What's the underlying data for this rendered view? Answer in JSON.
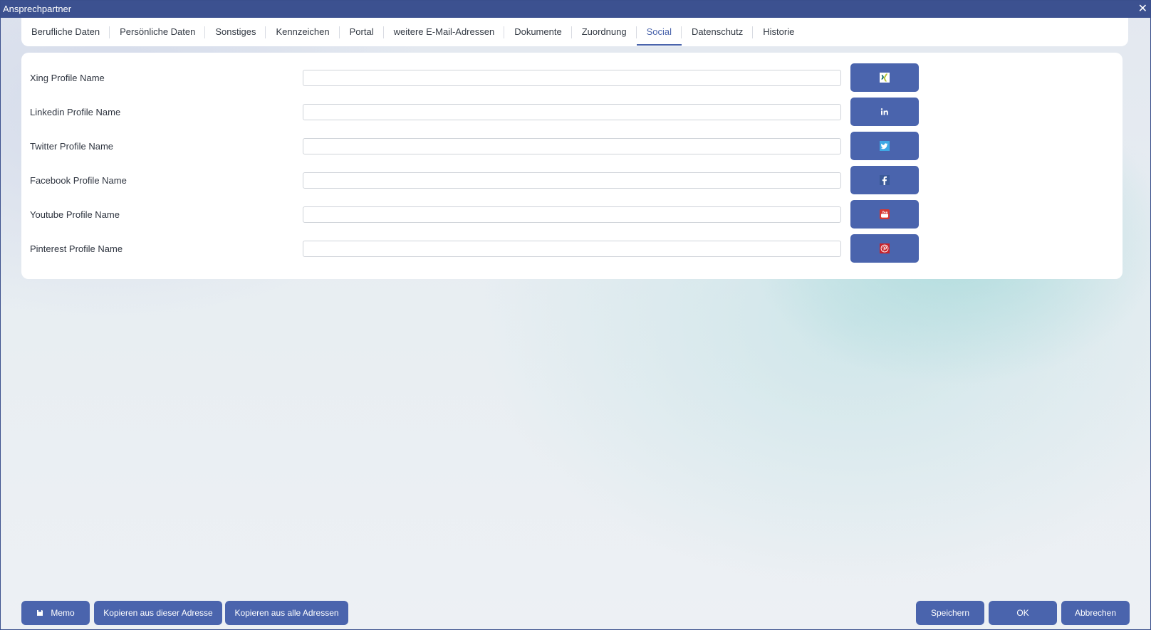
{
  "window": {
    "title": "Ansprechpartner",
    "close_glyph": "✕"
  },
  "tabs": [
    {
      "label": "Berufliche Daten",
      "active": false
    },
    {
      "label": "Persönliche Daten",
      "active": false
    },
    {
      "label": "Sonstiges",
      "active": false
    },
    {
      "label": "Kennzeichen",
      "active": false
    },
    {
      "label": "Portal",
      "active": false
    },
    {
      "label": "weitere E-Mail-Adressen",
      "active": false
    },
    {
      "label": "Dokumente",
      "active": false
    },
    {
      "label": "Zuordnung",
      "active": false
    },
    {
      "label": "Social",
      "active": true
    },
    {
      "label": "Datenschutz",
      "active": false
    },
    {
      "label": "Historie",
      "active": false
    }
  ],
  "social": {
    "rows": [
      {
        "label": "Xing Profile Name",
        "value": "",
        "icon": "xing-icon"
      },
      {
        "label": "Linkedin Profile Name",
        "value": "",
        "icon": "linkedin-icon"
      },
      {
        "label": "Twitter Profile Name",
        "value": "",
        "icon": "twitter-icon"
      },
      {
        "label": "Facebook Profile Name",
        "value": "",
        "icon": "facebook-icon"
      },
      {
        "label": "Youtube Profile Name",
        "value": "",
        "icon": "youtube-icon"
      },
      {
        "label": "Pinterest Profile Name",
        "value": "",
        "icon": "pinterest-icon"
      }
    ]
  },
  "footer": {
    "memo": "Memo",
    "copy_this": "Kopieren aus dieser Adresse",
    "copy_all": "Kopieren aus alle Adressen",
    "save": "Speichern",
    "ok": "OK",
    "cancel": "Abbrechen"
  },
  "colors": {
    "titlebar": "#3c5190",
    "accent": "#4a64ad",
    "active_tab": "#4a64ac"
  }
}
